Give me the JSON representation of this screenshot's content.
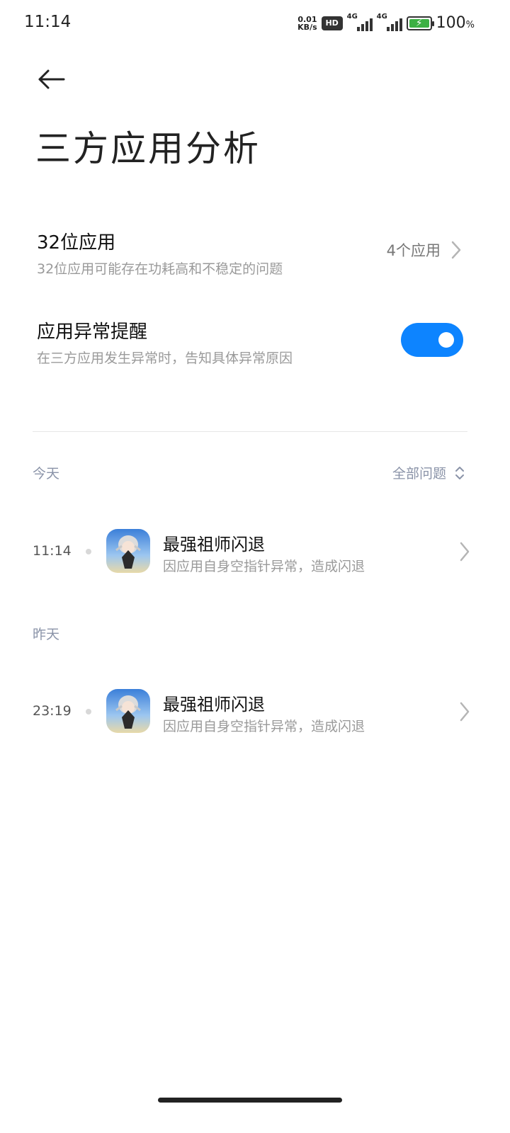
{
  "status_bar": {
    "time": "11:14",
    "net_speed_value": "0.01",
    "net_speed_unit": "KB/s",
    "hd_badge": "HD",
    "sim1_label": "4G",
    "sim2_label": "4G",
    "battery_percent": "100",
    "battery_percent_sign": "%",
    "battery_level": 1.0
  },
  "header": {
    "title": "三方应用分析"
  },
  "settings": {
    "app32": {
      "title": "32位应用",
      "subtitle": "32位应用可能存在功耗高和不稳定的问题",
      "value": "4个应用"
    },
    "alert": {
      "title": "应用异常提醒",
      "subtitle": "在三方应用发生异常时，告知具体异常原因",
      "enabled": true
    }
  },
  "log": {
    "filter_label": "全部问题",
    "sections": [
      {
        "label": "今天",
        "events": [
          {
            "time": "11:14",
            "title": "最强祖师闪退",
            "subtitle": "因应用自身空指针异常，造成闪退"
          }
        ]
      },
      {
        "label": "昨天",
        "events": [
          {
            "time": "23:19",
            "title": "最强祖师闪退",
            "subtitle": "因应用自身空指针异常，造成闪退"
          }
        ]
      }
    ]
  },
  "colors": {
    "accent": "#0d84ff",
    "section_label": "#8a93a8",
    "subtitle_text": "#9a9a9a"
  }
}
